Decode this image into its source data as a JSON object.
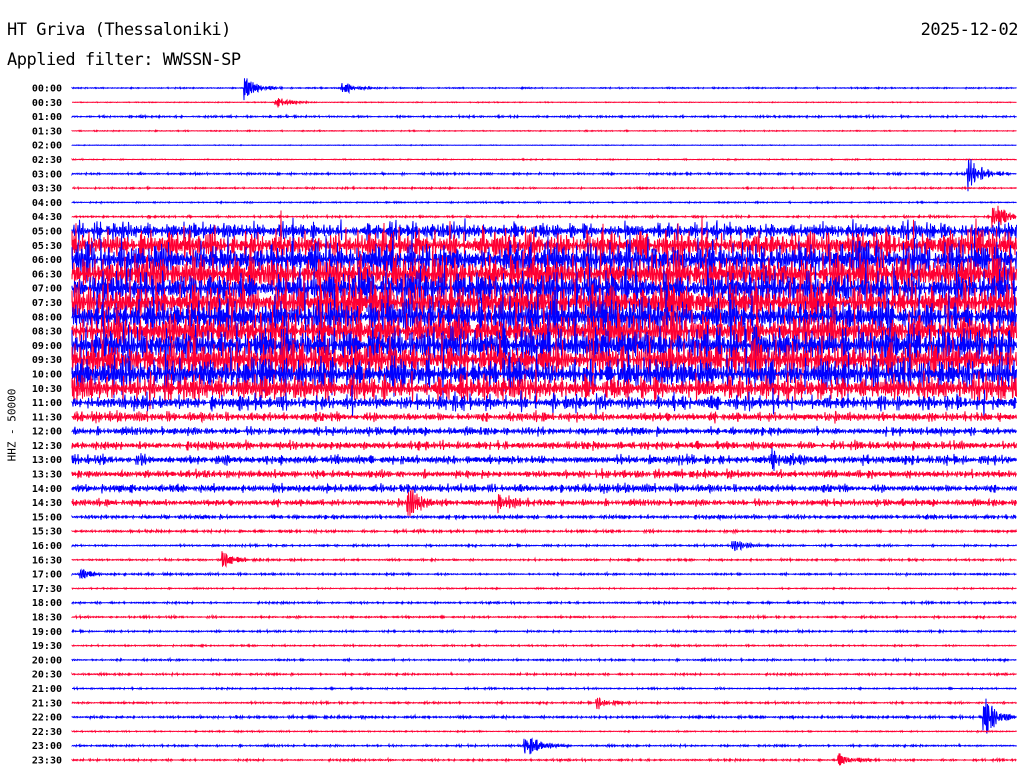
{
  "header": {
    "station": "HT Griva (Thessaloniki)",
    "date": "2025-12-02",
    "filter": "Applied filter: WWSSN-SP"
  },
  "chart_data": {
    "type": "line",
    "title": "HT Griva (Thessaloniki)",
    "subtitle": "Applied filter: WWSSN-SP",
    "ylabel": "HHZ - 50000",
    "xlabel": "",
    "minutes_per_row": 30,
    "row_labels": [
      "00:00",
      "00:30",
      "01:00",
      "01:30",
      "02:00",
      "02:30",
      "03:00",
      "03:30",
      "04:00",
      "04:30",
      "05:00",
      "05:30",
      "06:00",
      "06:30",
      "07:00",
      "07:30",
      "08:00",
      "08:30",
      "09:00",
      "09:30",
      "10:00",
      "10:30",
      "11:00",
      "11:30",
      "12:00",
      "12:30",
      "13:00",
      "13:30",
      "14:00",
      "14:30",
      "15:00",
      "15:30",
      "16:00",
      "16:30",
      "17:00",
      "17:30",
      "18:00",
      "18:30",
      "19:00",
      "19:30",
      "20:00",
      "20:30",
      "21:00",
      "21:30",
      "22:00",
      "22:30",
      "23:00",
      "23:30"
    ],
    "row_colors": [
      "#0000ff",
      "#ff0033"
    ],
    "noise_level": [
      1,
      0.6,
      1.5,
      0.8,
      0.5,
      0.8,
      1.5,
      1.2,
      1,
      1.5,
      12,
      20,
      25,
      25,
      25,
      25,
      25,
      25,
      25,
      25,
      22,
      18,
      10,
      7,
      6,
      6,
      7,
      6,
      6,
      5,
      3,
      2,
      1.5,
      1.5,
      1.5,
      1,
      1.5,
      1.5,
      1.5,
      1.2,
      1.5,
      1.5,
      1.2,
      1.5,
      2,
      1,
      1.5,
      1.5
    ],
    "events": [
      {
        "row": 0,
        "minute": 5.5,
        "amplitude": 12
      },
      {
        "row": 0,
        "minute": 8.6,
        "amplitude": 6
      },
      {
        "row": 1,
        "minute": 6.5,
        "amplitude": 6
      },
      {
        "row": 6,
        "minute": 28.5,
        "amplitude": 20
      },
      {
        "row": 9,
        "minute": 29.3,
        "amplitude": 15
      },
      {
        "row": 26,
        "minute": 22.2,
        "amplitude": 10
      },
      {
        "row": 29,
        "minute": 10.7,
        "amplitude": 15
      },
      {
        "row": 29,
        "minute": 13.6,
        "amplitude": 10
      },
      {
        "row": 32,
        "minute": 21,
        "amplitude": 7
      },
      {
        "row": 33,
        "minute": 4.8,
        "amplitude": 8
      },
      {
        "row": 34,
        "minute": 0.3,
        "amplitude": 5
      },
      {
        "row": 43,
        "minute": 16.7,
        "amplitude": 7
      },
      {
        "row": 44,
        "minute": 29,
        "amplitude": 20
      },
      {
        "row": 46,
        "minute": 14.4,
        "amplitude": 14
      },
      {
        "row": 47,
        "minute": 24.4,
        "amplitude": 6
      }
    ]
  }
}
